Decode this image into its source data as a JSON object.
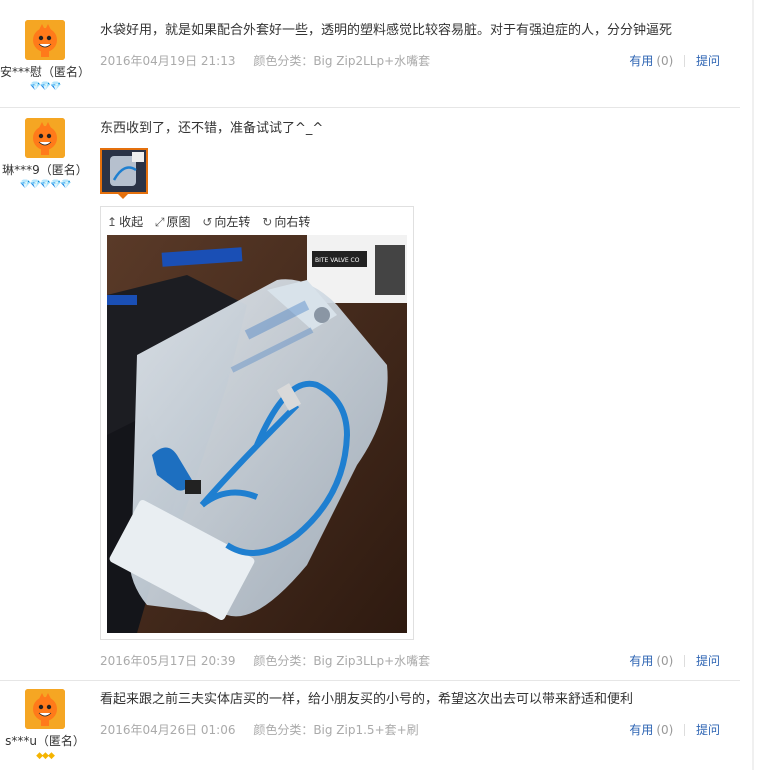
{
  "reviews": [
    {
      "nickname": "安***慰（匿名）",
      "badges": "💎💎💎",
      "text": "水袋好用，就是如果配合外套好一些，透明的塑料感觉比较容易脏。对于有强迫症的人，分分钟逼死",
      "date": "2016年04月19日 21:13",
      "variant": "颜色分类：Big Zip2LLp+水嘴套",
      "useful_label": "有用",
      "useful_count": "(0)",
      "reply_label": "提问"
    },
    {
      "nickname": "琳***9（匿名）",
      "badges": "💎💎💎💎💎",
      "text": "东西收到了，还不错，准备试试了^_^",
      "date": "2016年05月17日 20:39",
      "variant": "颜色分类：Big Zip3LLp+水嘴套",
      "useful_label": "有用",
      "useful_count": "(0)",
      "reply_label": "提问",
      "viewer": {
        "collapse": "收起",
        "original": "原图",
        "rotate_left": "向左转",
        "rotate_right": "向右转"
      }
    },
    {
      "nickname": "s***u（匿名）",
      "badges": "◆◆◆",
      "text": "看起来跟之前三夫实体店买的一样，给小朋友买的小号的，希望这次出去可以带来舒适和便利",
      "date": "2016年04月26日 01:06",
      "variant": "颜色分类：Big Zip1.5+套+刷",
      "useful_label": "有用",
      "useful_count": "(0)",
      "reply_label": "提问"
    }
  ],
  "colors": {
    "link": "#2d64b3",
    "meta": "#aaaaaa",
    "thumb_border": "#e4700d",
    "avatar": "#f5a623"
  },
  "photo_labels": {
    "box_text": "BITE VALVE CO"
  }
}
